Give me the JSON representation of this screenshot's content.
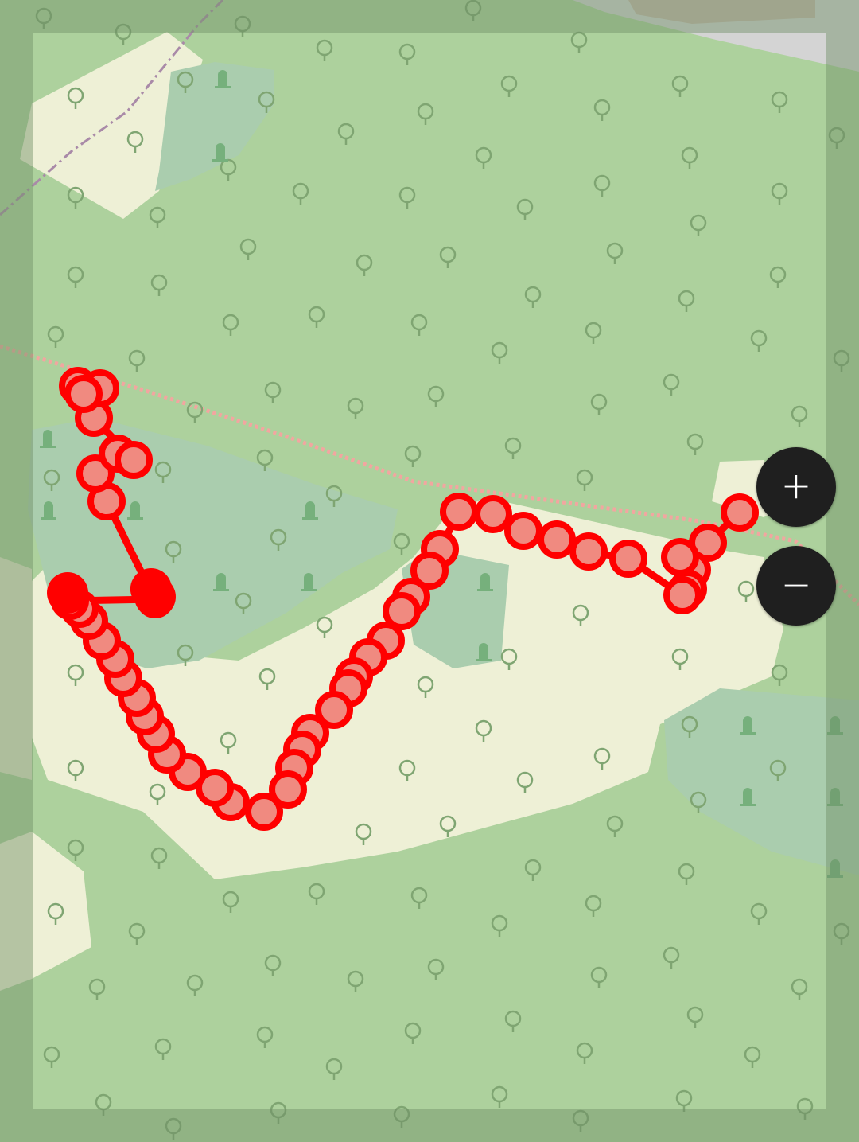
{
  "map": {
    "colors": {
      "forest": "#add19d",
      "grass": "#eef0d6",
      "wetland": "#aacdae",
      "track": "#ff0000",
      "marker_fill": "#f08a80",
      "overlay": "#8da883",
      "road": "#c9c9c9",
      "building": "#c4b2a6"
    },
    "icons": {
      "tree": "tree-icon",
      "grave": "grave-icon"
    }
  },
  "zoom": {
    "in_label": "+",
    "out_label": "−"
  }
}
